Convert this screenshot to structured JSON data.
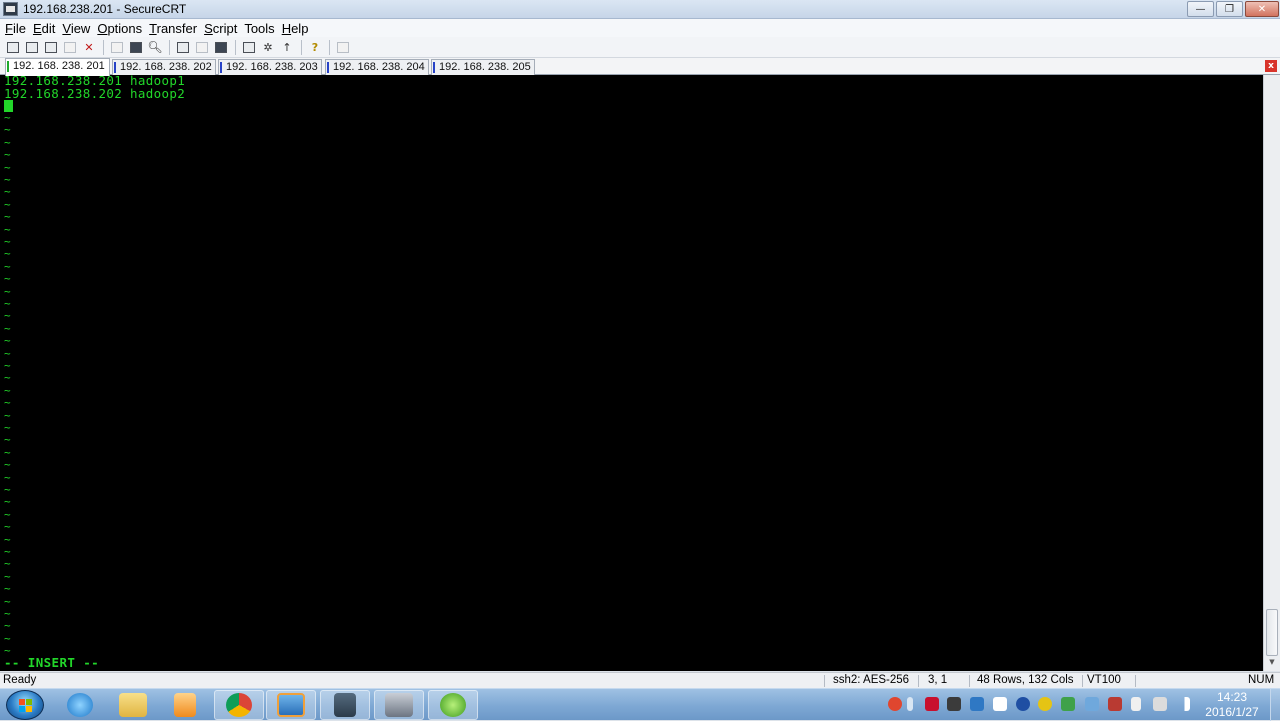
{
  "window": {
    "title": "192.168.238.201 - SecureCRT",
    "controls": {
      "minimize": "—",
      "maximize": "❐",
      "close": "✕"
    }
  },
  "menu": {
    "items": [
      {
        "label": "File",
        "accel": "F",
        "rest": "ile"
      },
      {
        "label": "Edit",
        "accel": "E",
        "rest": "dit"
      },
      {
        "label": "View",
        "accel": "V",
        "rest": "iew"
      },
      {
        "label": "Options",
        "accel": "O",
        "rest": "ptions"
      },
      {
        "label": "Transfer",
        "accel": "T",
        "rest": "ransfer"
      },
      {
        "label": "Script",
        "accel": "S",
        "rest": "cript"
      },
      {
        "label": "Tools",
        "accel": "",
        "rest": "Tools"
      },
      {
        "label": "Help",
        "accel": "H",
        "rest": "elp"
      }
    ]
  },
  "toolbar": {
    "buttons": [
      "connect-icon",
      "quick-connect-icon",
      "connect-in-tab-icon",
      "reconnect-icon",
      "disconnect-icon",
      "copy-icon",
      "paste-icon",
      "find-icon",
      "print-icon",
      "print-selection-icon",
      "printer-icon",
      "session-options-icon",
      "global-options-icon",
      "keymap-icon",
      "help-icon",
      "sftp-icon"
    ]
  },
  "tabs": [
    {
      "label": "192. 168. 238. 201",
      "active": true
    },
    {
      "label": "192. 168. 238. 202",
      "active": false
    },
    {
      "label": "192. 168. 238. 203",
      "active": false
    },
    {
      "label": "192. 168. 238. 204",
      "active": false
    },
    {
      "label": "192. 168. 238. 205",
      "active": false
    }
  ],
  "tab_close": "x",
  "terminal": {
    "lines": [
      "192.168.238.201 hadoop1",
      "192.168.238.202 hadoop2"
    ],
    "tilde": "~",
    "mode": "-- INSERT --",
    "text_color": "#22d62a",
    "background": "#000000"
  },
  "statusbar": {
    "ready": "Ready",
    "encryption": "ssh2: AES-256",
    "position": "3,   1",
    "size": "48 Rows, 132 Cols",
    "emulation": "VT100",
    "num": "NUM"
  },
  "taskbar": {
    "clock_time": "14:23",
    "clock_date": "2016/1/27",
    "pinned": [
      "internet-explorer-icon",
      "file-explorer-icon",
      "media-player-icon",
      "chrome-icon",
      "securecrt-icon",
      "vpn-lock-icon",
      "terminal-app-icon",
      "browser-e-icon"
    ]
  }
}
